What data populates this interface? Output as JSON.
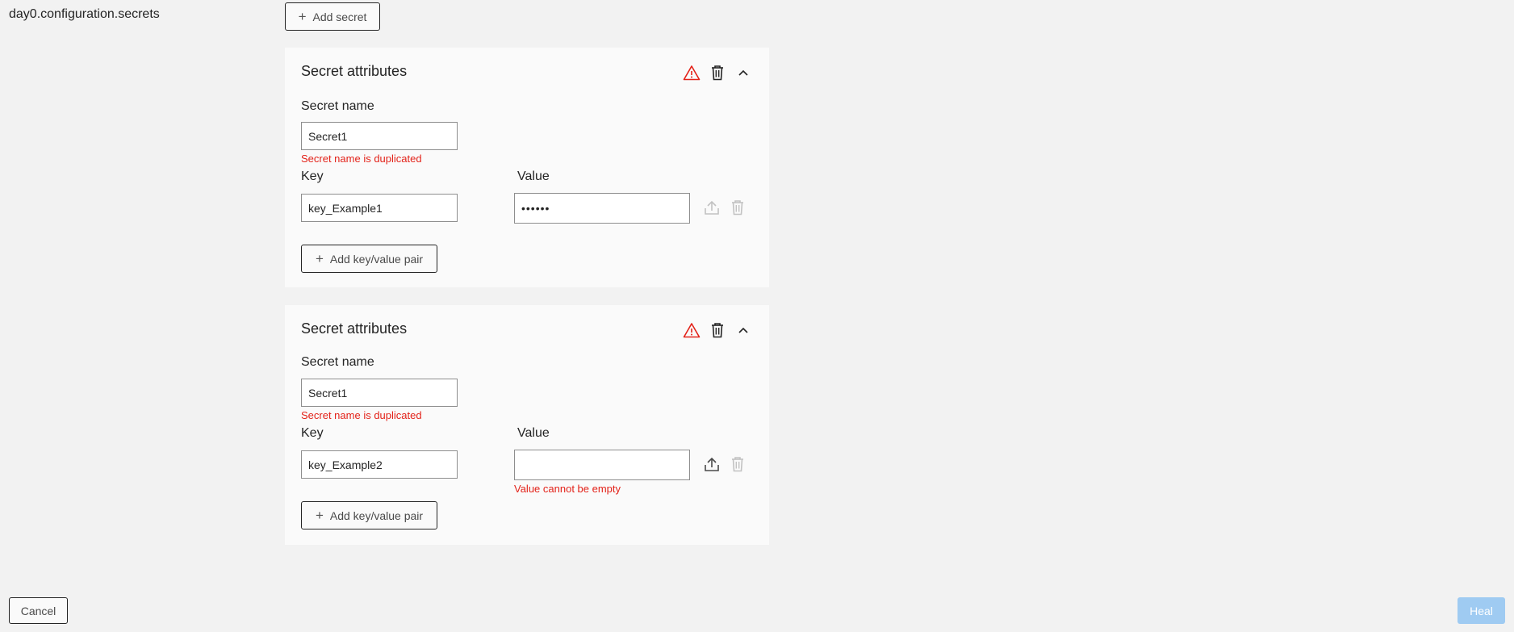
{
  "section_label": "day0.configuration.secrets",
  "add_secret_label": "Add secret",
  "cards": [
    {
      "title": "Secret attributes",
      "secret_name_label": "Secret name",
      "secret_name_value": "Secret1",
      "secret_name_error": "Secret name is duplicated",
      "key_label": "Key",
      "value_label": "Value",
      "key_value": "key_Example1",
      "value_value": "••••••",
      "value_error": "",
      "add_kv_label": "Add key/value pair"
    },
    {
      "title": "Secret attributes",
      "secret_name_label": "Secret name",
      "secret_name_value": "Secret1",
      "secret_name_error": "Secret name is duplicated",
      "key_label": "Key",
      "value_label": "Value",
      "key_value": "key_Example2",
      "value_value": "",
      "value_error": "Value cannot be empty",
      "add_kv_label": "Add key/value pair"
    }
  ],
  "footer": {
    "cancel_label": "Cancel",
    "heal_label": "Heal"
  },
  "colors": {
    "error": "#e32219",
    "disabled_primary": "#9fcbf2"
  }
}
